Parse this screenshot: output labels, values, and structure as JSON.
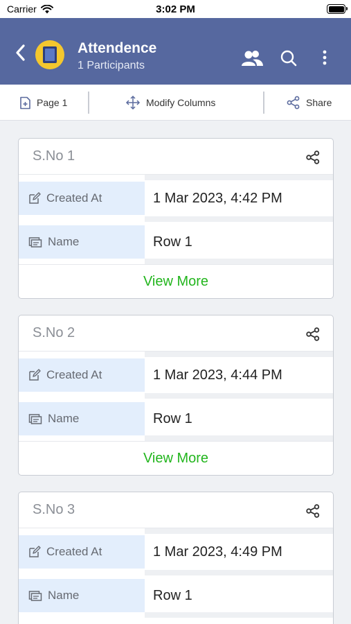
{
  "status_bar": {
    "carrier": "Carrier",
    "time": "3:02 PM"
  },
  "app_bar": {
    "title": "Attendence",
    "subtitle": "1 Participants",
    "icons": [
      "back-icon",
      "participants-icon",
      "search-icon",
      "more-icon"
    ],
    "color": "#56689f"
  },
  "toolbar": {
    "page_label": "Page 1",
    "modify_label": "Modify Columns",
    "share_label": "Share"
  },
  "cards": [
    {
      "title": "S.No 1",
      "fields": [
        {
          "label": "Created At",
          "value": "1 Mar 2023, 4:42 PM"
        },
        {
          "label": "Name",
          "value": "Row 1"
        }
      ],
      "view_more": "View More"
    },
    {
      "title": "S.No 2",
      "fields": [
        {
          "label": "Created At",
          "value": "1 Mar 2023, 4:44 PM"
        },
        {
          "label": "Name",
          "value": "Row 1"
        }
      ],
      "view_more": "View More"
    },
    {
      "title": "S.No 3",
      "fields": [
        {
          "label": "Created At",
          "value": "1 Mar 2023, 4:49 PM"
        },
        {
          "label": "Name",
          "value": "Row 1"
        }
      ]
    }
  ],
  "colors": {
    "accent_green": "#22b51d",
    "label_bg": "#e3eefc"
  }
}
